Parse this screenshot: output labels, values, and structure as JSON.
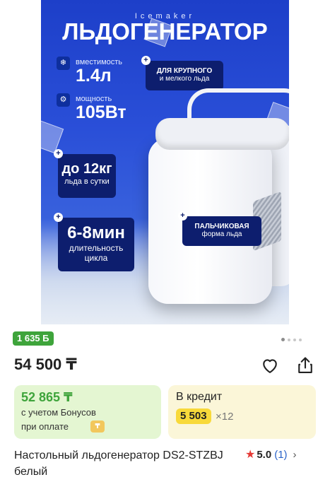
{
  "hero": {
    "brand_small": "Icemaker",
    "title": "ЛЬДОГЕНЕРАТОР",
    "capacity_label": "вместимость",
    "capacity_value": "1.4л",
    "power_label": "мощность",
    "power_value": "105Вт",
    "badge_ice_line1": "ДЛЯ КРУПНОГО",
    "badge_ice_line2": "и мелкого льда",
    "badge_daily_value": "до 12кг",
    "badge_daily_sub": "льда в сутки",
    "badge_time_value": "6-8мин",
    "badge_time_sub1": "длительность",
    "badge_time_sub2": "цикла",
    "badge_shape_line1": "ПАЛЬЧИКОВАЯ",
    "badge_shape_line2": "форма льда",
    "plus_glyph": "+",
    "capacity_icon": "ice-icon",
    "power_icon": "gear-icon"
  },
  "gallery": {
    "total": 4,
    "active": 1
  },
  "bonus_chip": "1 635 Б",
  "price": "54 500 ₸",
  "actions": {
    "favorite_icon": "heart-icon",
    "share_icon": "share-icon"
  },
  "bonus_card": {
    "amount": "52 865 ₸",
    "line1": "с учетом Бонусов",
    "line2": "при оплате",
    "pay_glyph": "₸"
  },
  "credit_card": {
    "title": "В кредит",
    "monthly": "5 503",
    "multiplier": "×12"
  },
  "product": {
    "title": "Настольный льдогенератор DS2-STZBJ белый",
    "rating": "5.0",
    "reviews": "(1)",
    "star": "★",
    "chevron": "›"
  },
  "colors": {
    "brand_green": "#3ea43b",
    "credit_yellow": "#f8d93a",
    "hero_blue": "#2a4fd8",
    "rating_star": "#e53935",
    "link_blue": "#2a63c9"
  }
}
